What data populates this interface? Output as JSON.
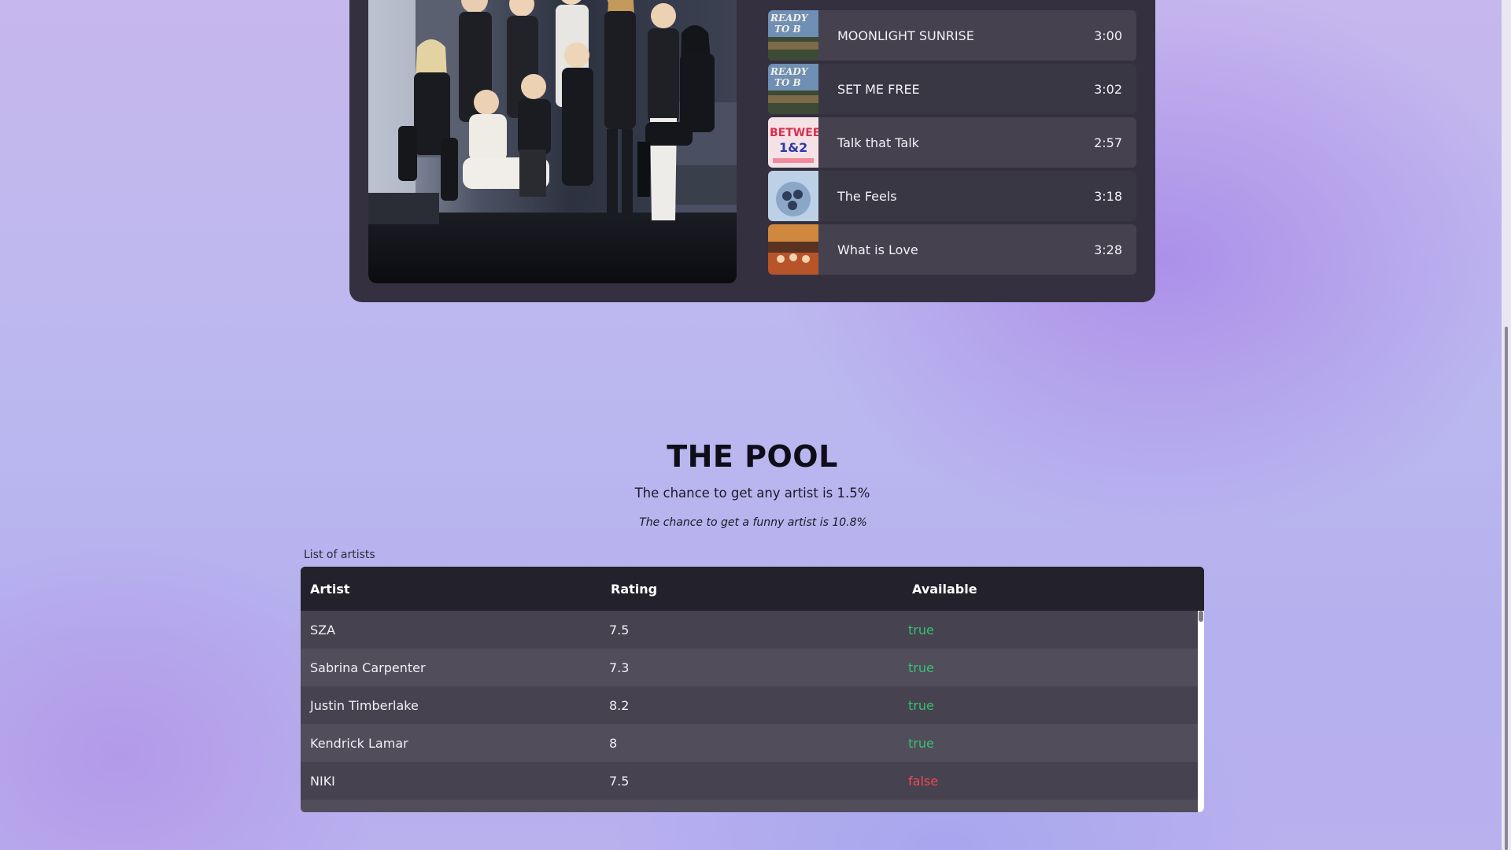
{
  "tracks": [
    {
      "title": "MOONLIGHT SUNRISE",
      "duration": "3:00",
      "art": "ready-to-be-album-art"
    },
    {
      "title": "SET ME FREE",
      "duration": "3:02",
      "art": "ready-to-be-album-art"
    },
    {
      "title": "Talk that Talk",
      "duration": "2:57",
      "art": "between-1-and-2-album-art"
    },
    {
      "title": "The Feels",
      "duration": "3:18",
      "art": "formula-of-love-album-art"
    },
    {
      "title": "What is Love",
      "duration": "3:28",
      "art": "summer-nights-album-art"
    }
  ],
  "art_text": {
    "ready": "READY",
    "to": "TO B",
    "between": "BETWEEN",
    "onetwo": "1&2"
  },
  "pool": {
    "title": "THE POOL",
    "subtitle": "The chance to get any artist is 1.5%",
    "subtitle_italic": "The chance to get a funny artist is 10.8%",
    "caption": "List of artists"
  },
  "table": {
    "headers": [
      "Artist",
      "Rating",
      "Available"
    ],
    "rows": [
      {
        "artist": "SZA",
        "rating": "7.5",
        "available": "true"
      },
      {
        "artist": "Sabrina Carpenter",
        "rating": "7.3",
        "available": "true"
      },
      {
        "artist": "Justin Timberlake",
        "rating": "8.2",
        "available": "true"
      },
      {
        "artist": "Kendrick Lamar",
        "rating": "8",
        "available": "true"
      },
      {
        "artist": "NIKI",
        "rating": "7.5",
        "available": "false"
      }
    ]
  },
  "colors": {
    "available_true": "#38c172",
    "available_false": "#ef4a55",
    "card_bg": "#34303f"
  }
}
